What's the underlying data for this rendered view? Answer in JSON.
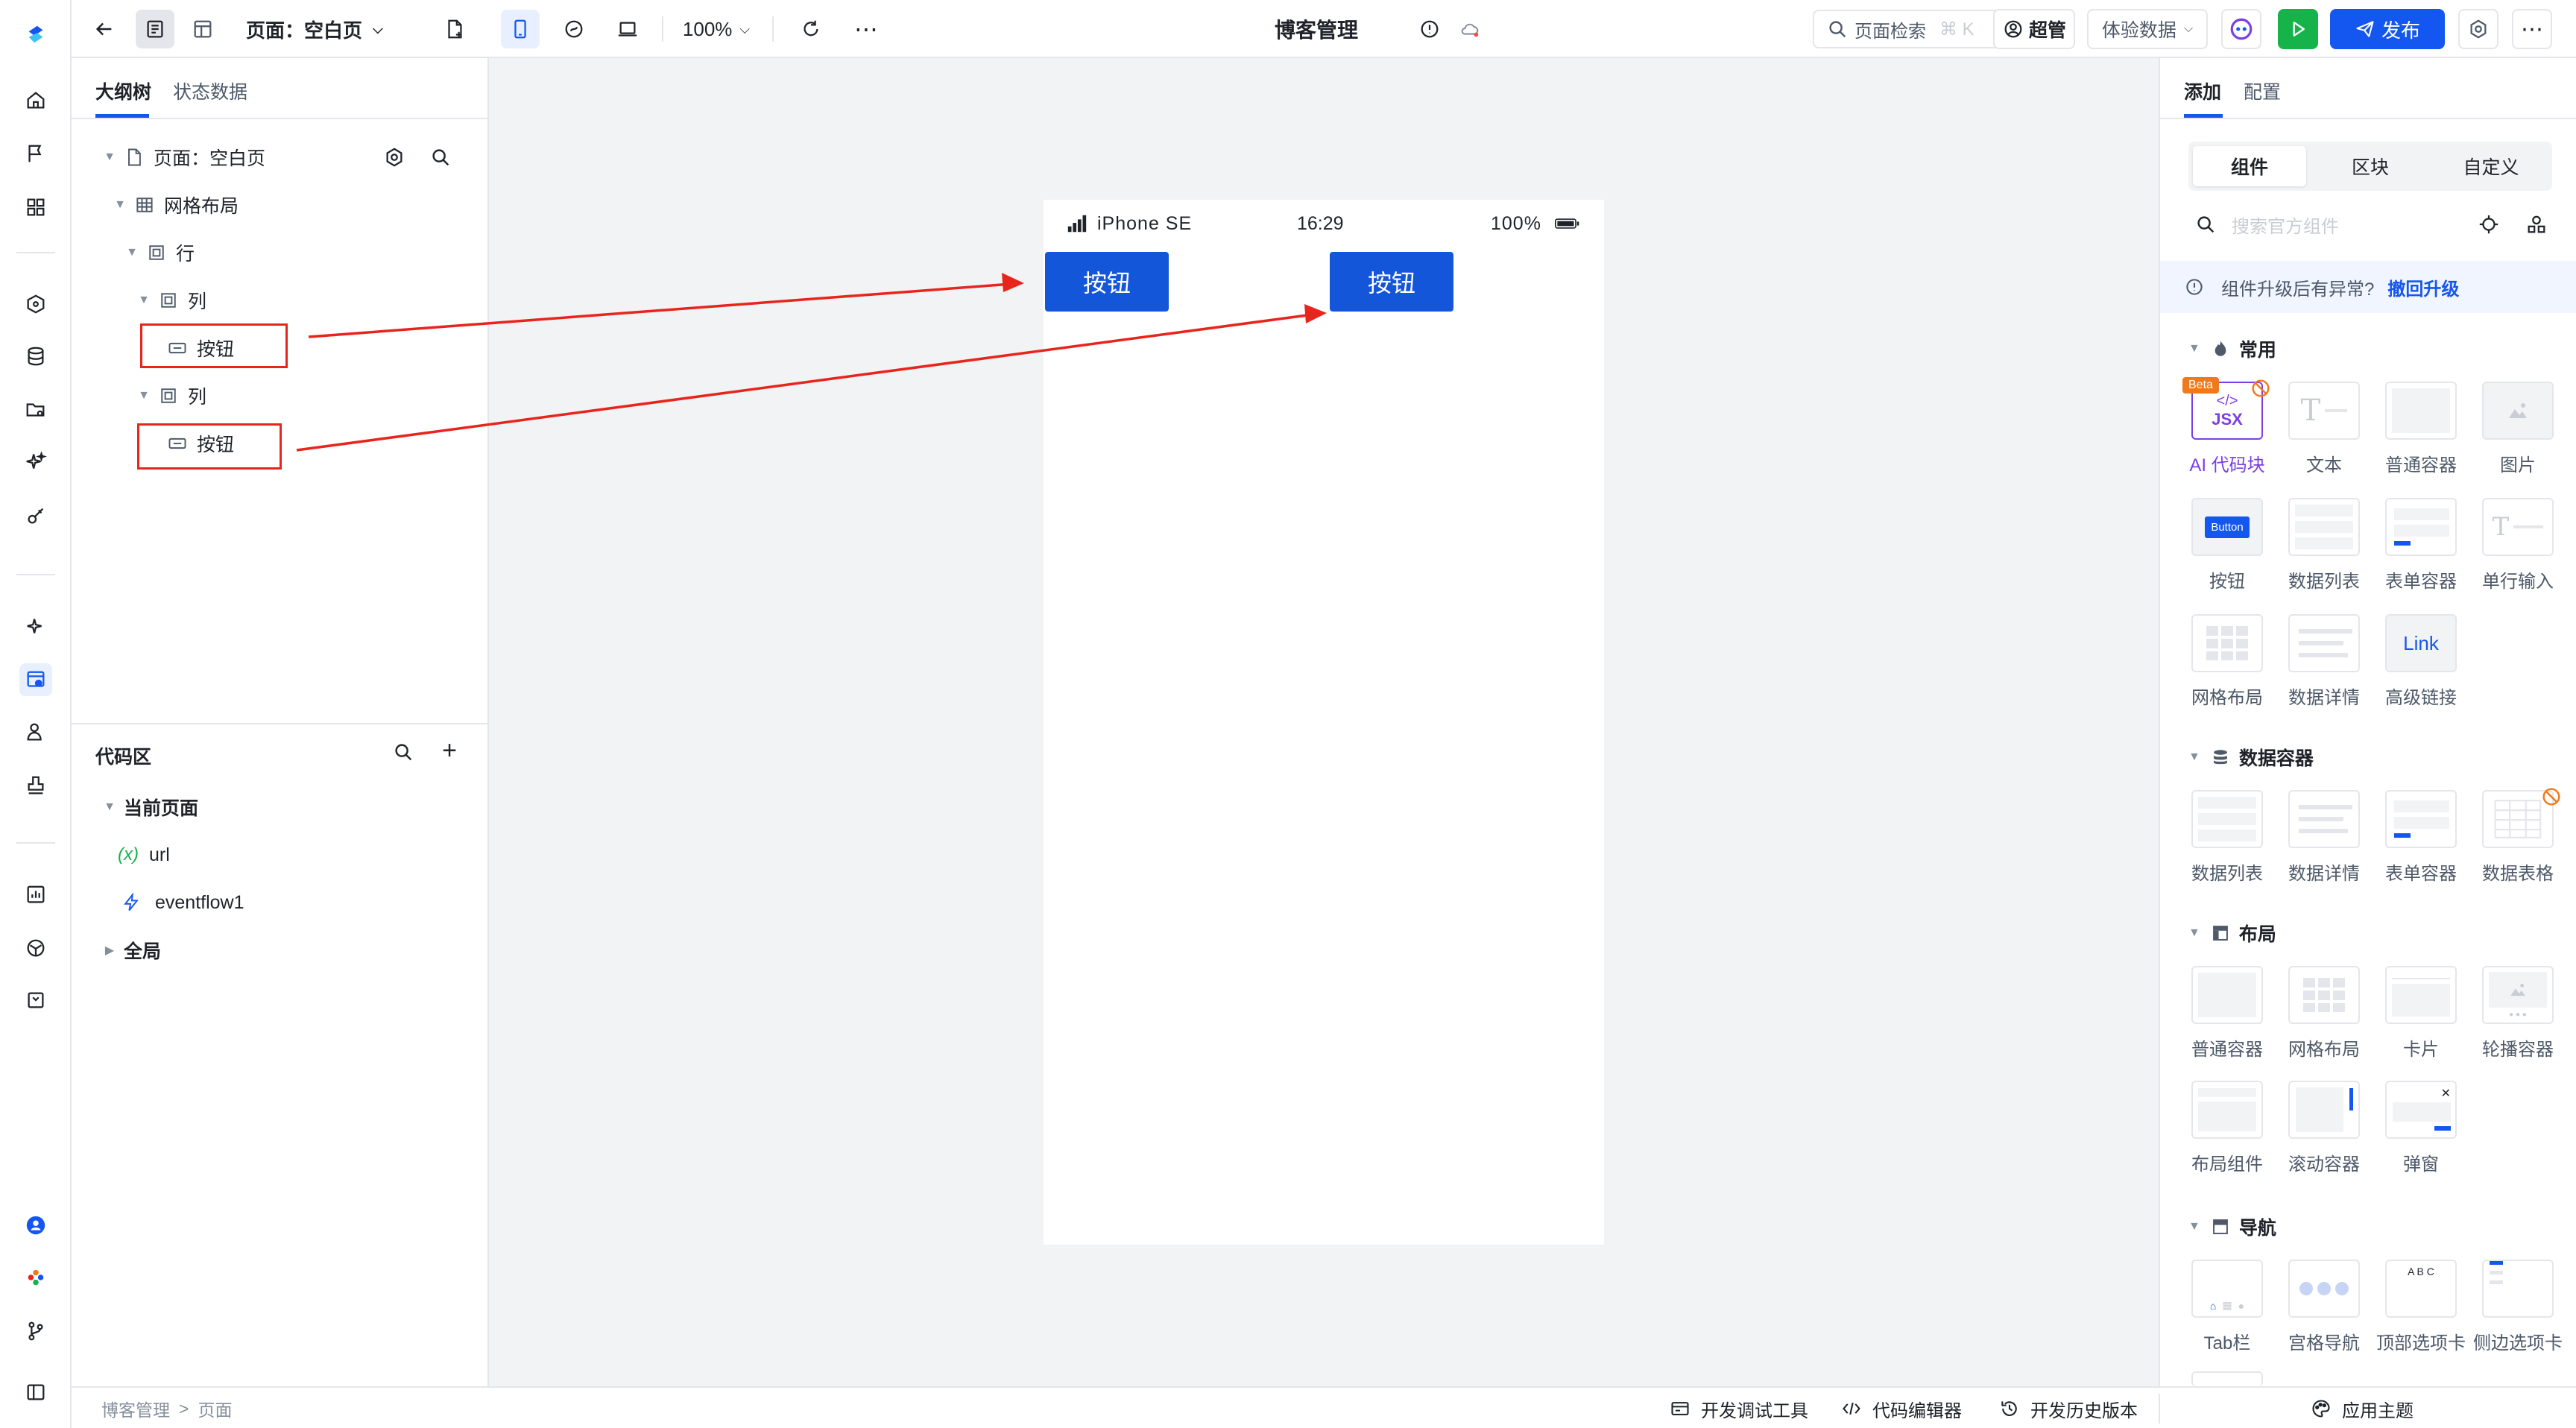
{
  "toolbar": {
    "page_selector": "页面：空白页",
    "zoom": "100%",
    "app_title": "博客管理",
    "page_search": "页面检索",
    "page_search_shortcut": "⌘ K",
    "user_role": "超管",
    "experience_data": "体验数据",
    "publish": "发布"
  },
  "outline": {
    "tabs": [
      "大纲树",
      "状态数据"
    ],
    "tree": {
      "page": "页面：空白页",
      "grid": "网格布局",
      "row": "行",
      "col1": "列",
      "btn1": "按钮",
      "col2": "列",
      "btn2": "按钮"
    },
    "code_area": {
      "title": "代码区",
      "current_page": "当前页面",
      "var_prefix": "(x)",
      "url": "url",
      "eventflow": "eventflow1",
      "global": "全局"
    }
  },
  "preview": {
    "device": "iPhone SE",
    "time": "16:29",
    "battery": "100%",
    "buttons": [
      "按钮",
      "按钮"
    ]
  },
  "right_panel": {
    "tabs": [
      "添加",
      "配置"
    ],
    "segments": [
      "组件",
      "区块",
      "自定义"
    ],
    "search_placeholder": "搜索官方组件",
    "notice_text": "组件升级后有异常?",
    "notice_link": "撤回升级",
    "sections": [
      {
        "title": "常用",
        "items": [
          "AI 代码块",
          "文本",
          "普通容器",
          "图片",
          "按钮",
          "数据列表",
          "表单容器",
          "单行输入",
          "网格布局",
          "数据详情",
          "高级链接"
        ]
      },
      {
        "title": "数据容器",
        "items": [
          "数据列表",
          "数据详情",
          "表单容器",
          "数据表格"
        ]
      },
      {
        "title": "布局",
        "items": [
          "普通容器",
          "网格布局",
          "卡片",
          "轮播容器",
          "布局组件",
          "滚动容器",
          "弹窗"
        ]
      },
      {
        "title": "导航",
        "items": [
          "Tab栏",
          "宫格导航",
          "顶部选项卡",
          "侧边选项卡"
        ]
      }
    ],
    "badges": {
      "beta": "Beta",
      "jsx": "JSX",
      "button_thumb": "Button",
      "link_thumb": "Link",
      "abc": "A  B  C"
    }
  },
  "bottom_bar": {
    "breadcrumb": [
      "博客管理",
      "页面"
    ],
    "breadcrumb_sep": ">",
    "dev_tools": "开发调试工具",
    "code_editor": "代码编辑器",
    "history": "开发历史版本",
    "theme": "应用主题"
  },
  "colors": {
    "primary": "#1456f0",
    "publish_bg": "#1456f0",
    "run_bg": "#16b34a",
    "ai_purple": "#7b3fe4",
    "beta_orange": "#f07a1a",
    "annotation_red": "#e8251c"
  }
}
